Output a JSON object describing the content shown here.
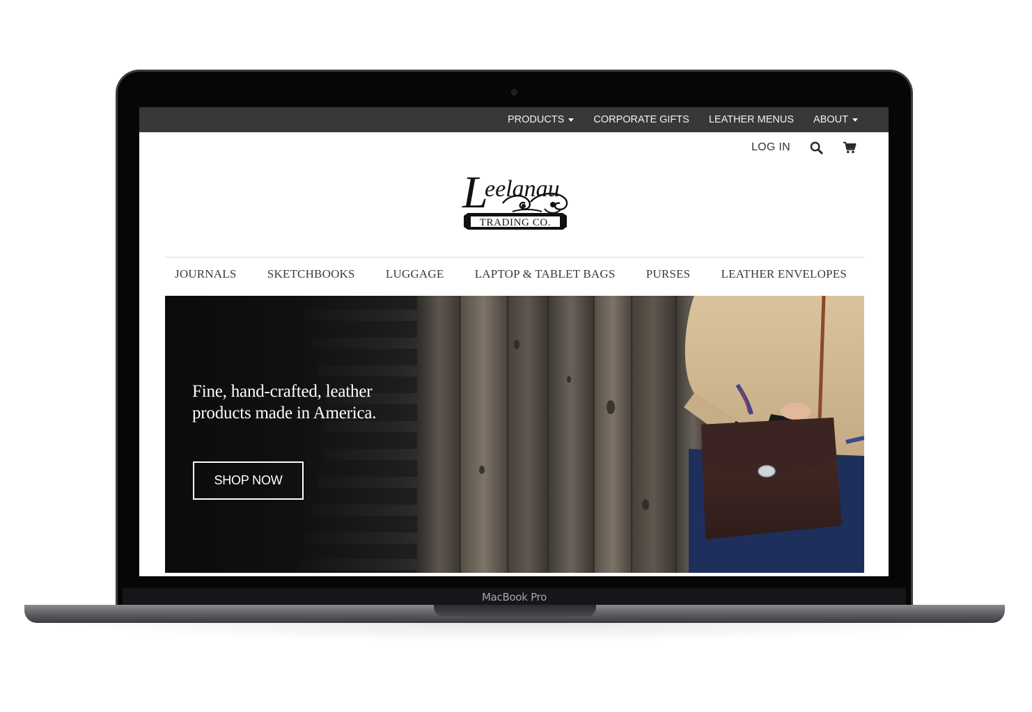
{
  "device": {
    "label": "MacBook Pro"
  },
  "topbar": {
    "items": [
      {
        "label": "PRODUCTS",
        "dropdown": true
      },
      {
        "label": "CORPORATE GIFTS",
        "dropdown": false
      },
      {
        "label": "LEATHER MENUS",
        "dropdown": false
      },
      {
        "label": "ABOUT",
        "dropdown": true
      }
    ]
  },
  "utility": {
    "login_label": "LOG IN",
    "search_icon": "search-icon",
    "cart_icon": "cart-icon"
  },
  "logo": {
    "wordmark": "Leelanau",
    "subline": "TRADING CO."
  },
  "mainnav": {
    "items": [
      {
        "label": "JOURNALS"
      },
      {
        "label": "SKETCHBOOKS"
      },
      {
        "label": "LUGGAGE"
      },
      {
        "label": "LAPTOP & TABLET BAGS"
      },
      {
        "label": "PURSES"
      },
      {
        "label": "LEATHER ENVELOPES"
      }
    ]
  },
  "hero": {
    "headline": "Fine, hand-crafted, leather products made in America.",
    "cta_label": "SHOP NOW"
  },
  "colors": {
    "topbar_bg": "#383838",
    "nav_text": "#3a3a3a",
    "hero_text": "#ffffff"
  }
}
